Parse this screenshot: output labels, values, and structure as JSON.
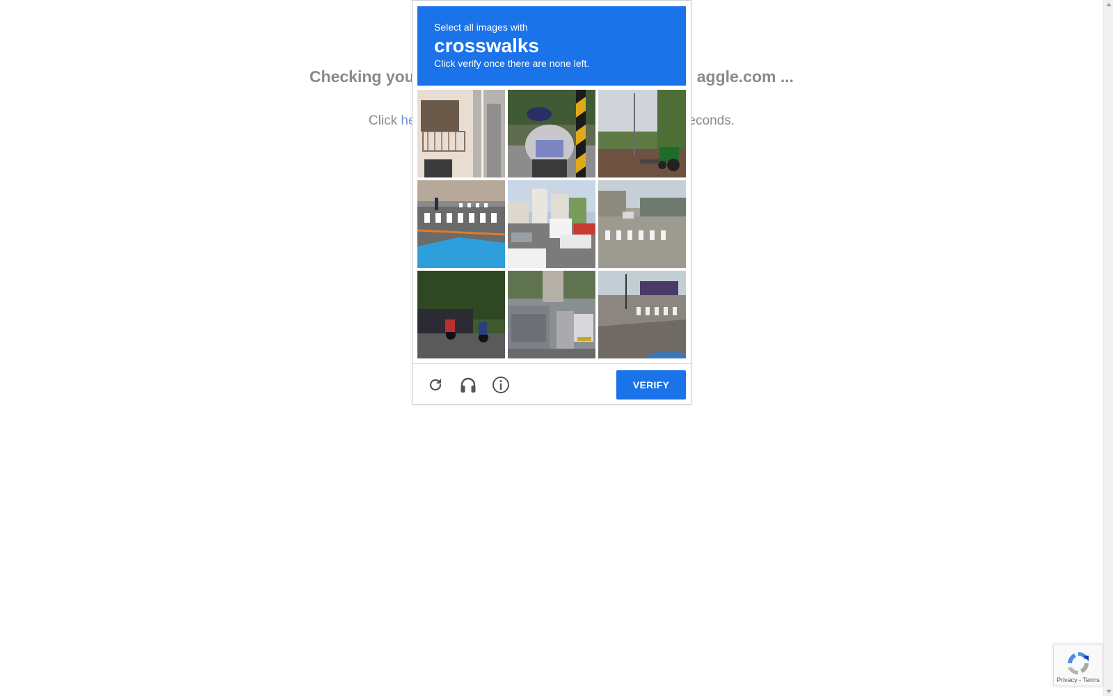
{
  "background": {
    "heading": "Checking you",
    "heading_tail": "aggle.com ...",
    "line_prefix": "Click",
    "line_link": "he",
    "line_suffix": "econds."
  },
  "captcha": {
    "instruction": "Select all images with",
    "keyword": "crosswalks",
    "sub_instruction": "Click verify once there are none left.",
    "tiles": [
      {
        "label": "balcony"
      },
      {
        "label": "motorcycle"
      },
      {
        "label": "tractor"
      },
      {
        "label": "crosswalk"
      },
      {
        "label": "street"
      },
      {
        "label": "crosswalk"
      },
      {
        "label": "motorcycles"
      },
      {
        "label": "traffic"
      },
      {
        "label": "crosswalk"
      }
    ],
    "tools": {
      "reload_icon": "reload-icon",
      "audio_icon": "headphones-icon",
      "info_icon": "info-icon"
    },
    "verify_label": "VERIFY",
    "accent": "#1a73e8"
  },
  "badge": {
    "privacy": "Privacy",
    "separator": "-",
    "terms": "Terms"
  }
}
